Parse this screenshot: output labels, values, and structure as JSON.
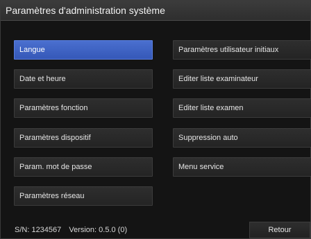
{
  "window": {
    "title": "Paramètres d'administration système"
  },
  "left_menu": [
    {
      "label": "Langue",
      "selected": true
    },
    {
      "label": "Date et heure",
      "selected": false
    },
    {
      "label": "Paramètres fonction",
      "selected": false
    },
    {
      "label": "Paramètres dispositif",
      "selected": false
    },
    {
      "label": "Param. mot de passe",
      "selected": false
    },
    {
      "label": "Paramètres réseau",
      "selected": false
    }
  ],
  "right_menu": [
    {
      "label": "Paramètres utilisateur initiaux"
    },
    {
      "label": "Editer liste examinateur"
    },
    {
      "label": "Editer liste examen"
    },
    {
      "label": "Suppression auto"
    },
    {
      "label": "Menu service"
    }
  ],
  "footer": {
    "serial": "S/N: 1234567",
    "version": "Version: 0.5.0 (0)",
    "back_label": "Retour"
  },
  "colors": {
    "accent": "#3f63c4",
    "background": "#141414",
    "button": "#282828"
  }
}
